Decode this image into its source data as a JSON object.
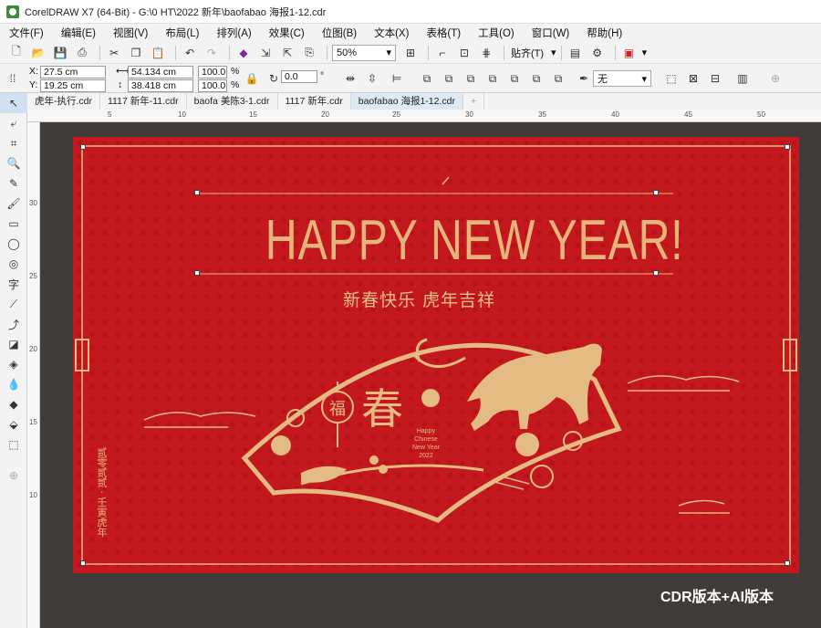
{
  "window": {
    "title": "CorelDRAW X7 (64-Bit) - G:\\0 HT\\2022 新年\\baofabao 海报1-12.cdr"
  },
  "menu": [
    "文件(F)",
    "编辑(E)",
    "视图(V)",
    "布局(L)",
    "排列(A)",
    "效果(C)",
    "位图(B)",
    "文本(X)",
    "表格(T)",
    "工具(O)",
    "窗口(W)",
    "帮助(H)"
  ],
  "toolbar": {
    "zoom": "50%",
    "snap": "贴齐(T)"
  },
  "props": {
    "x": "27.5 cm",
    "y": "19.25 cm",
    "w": "54.134 cm",
    "h": "38.418 cm",
    "sx": "100.0",
    "sy": "100.0",
    "pct": "%",
    "angle": "0.0",
    "deg": "°",
    "outline": "无"
  },
  "tabs": [
    "虎年-执行.cdr",
    "1117 新年-11.cdr",
    "baofa 美陈3-1.cdr",
    "1117 新年.cdr",
    "baofabao 海报1-12.cdr"
  ],
  "ruler": {
    "h_ticks": [
      "5",
      "10",
      "15",
      "20",
      "25",
      "30",
      "35",
      "40",
      "45",
      "50"
    ],
    "v_ticks": [
      "30",
      "25",
      "20",
      "15",
      "10"
    ]
  },
  "poster": {
    "headline": "HAPPY NEW YEAR!",
    "subhead": "新春快乐   虎年吉祥",
    "fu": "福",
    "chun": "春",
    "small_en": [
      "Happy",
      "Chinese",
      "New Year",
      "2022"
    ],
    "side_text": "贰零贰贰 · 壬寅虎年"
  },
  "watermark": "CDR版本+AI版本",
  "colors": {
    "poster_red": "#c2181e",
    "gold": "#e4bb82",
    "canvas": "#3f3c3a"
  }
}
